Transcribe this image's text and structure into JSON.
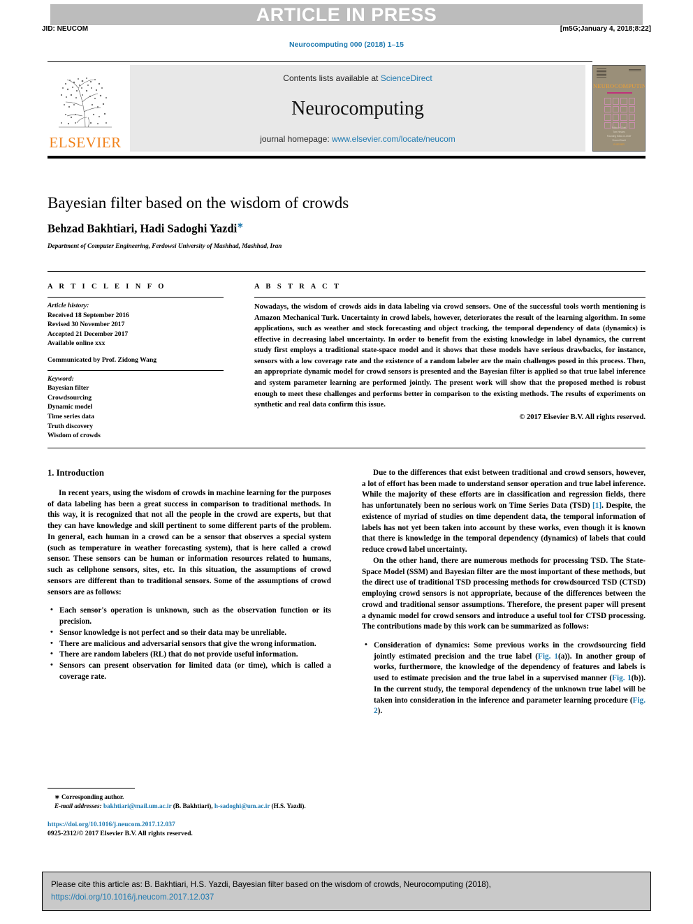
{
  "banner": {
    "press_label": "ARTICLE IN PRESS",
    "jid": "JID: NEUCOM",
    "build_stamp": "[m5G;January 4, 2018;8:22]",
    "journal_ref": "Neurocomputing 000 (2018) 1–15"
  },
  "masthead": {
    "contents_prefix": "Contents lists available at ",
    "sciencedirect": "ScienceDirect",
    "journal_name": "Neurocomputing",
    "homepage_prefix": "journal homepage: ",
    "homepage_url": "www.elsevier.com/locate/neucom",
    "publisher": "ELSEVIER",
    "cover_title": "NEUROCOMPUTING",
    "cover_sub": "AN INTERNATIONAL JOURNAL",
    "cover_line1": "Editor-in-Chief",
    "cover_line2": "Tom Heskes",
    "cover_line3": "Founding Editor-in-Chief",
    "cover_line4": "Vincent David",
    "cover_line5": "ELSEVIER"
  },
  "article": {
    "title": "Bayesian filter based on the wisdom of crowds",
    "authors": "Behzad Bakhtiari, Hadi Sadoghi Yazdi",
    "corresponding_marker": "∗",
    "affiliation": "Department of Computer Engineering, Ferdowsi University of Mashhad, Mashhad, Iran"
  },
  "info": {
    "heading": "A R T I C L E   I N F O",
    "history_label": "Article history:",
    "received": "Received 18 September 2016",
    "revised": "Revised 30 November 2017",
    "accepted": "Accepted 21 December 2017",
    "available": "Available online xxx",
    "communicated": "Communicated by Prof. Zidong Wang",
    "keyword_label": "Keyword:",
    "keywords": [
      "Bayesian filter",
      "Crowdsourcing",
      "Dynamic model",
      "Time series data",
      "Truth discovery",
      "Wisdom of crowds"
    ]
  },
  "abstract": {
    "heading": "A B S T R A C T",
    "text": "Nowadays, the wisdom of crowds aids in data labeling via crowd sensors. One of the successful tools worth mentioning is Amazon Mechanical Turk. Uncertainty in crowd labels, however, deteriorates the result of the learning algorithm. In some applications, such as weather and stock forecasting and object tracking, the temporal dependency of data (dynamics) is effective in decreasing label uncertainty. In order to benefit from the existing knowledge in label dynamics, the current study first employs a traditional state-space model and it shows that these models have serious drawbacks, for instance, sensors with a low coverage rate and the existence of a random labeler are the main challenges posed in this process. Then, an appropriate dynamic model for crowd sensors is presented and the Bayesian filter is applied so that true label inference and system parameter learning are performed jointly. The present work will show that the proposed method is robust enough to meet these challenges and performs better in comparison to the existing methods. The results of experiments on synthetic and real data confirm this issue.",
    "copyright": "© 2017 Elsevier B.V. All rights reserved."
  },
  "intro": {
    "heading": "1. Introduction",
    "para1": "In recent years, using the wisdom of crowds in machine learning for the purposes of data labeling has been a great success in comparison to traditional methods. In this way, it is recognized that not all the people in the crowd are experts, but that they can have knowledge and skill pertinent to some different parts of the problem. In general, each human in a crowd can be a sensor that observes a special system (such as temperature in weather forecasting system), that is here called a crowd sensor. These sensors can be human or information resources related to humans, such as cellphone sensors, sites, etc. In this situation, the assumptions of crowd sensors are different than to traditional sensors. Some of the assumptions of crowd sensors are as follows:",
    "bullets": [
      "Each sensor's operation is unknown, such as the observation function or its precision.",
      "Sensor knowledge is not perfect and so their data may be unreliable.",
      "There are malicious and adversarial sensors that give the wrong information.",
      "There are random labelers (RL) that do not provide useful information.",
      "Sensors can present observation for limited data (or time), which is called a coverage rate."
    ]
  },
  "right_col": {
    "para1": "Due to the differences that exist between traditional and crowd sensors, however, a lot of effort has been made to understand sensor operation and true label inference. While the majority of these efforts are in classification and regression fields, there has unfortunately been no serious work on Time Series Data (TSD)",
    "ref1": "[1]",
    "para1_cont": ". Despite, the existence of myriad of studies on time dependent data, the temporal information of labels has not yet been taken into account by these works, even though it is known that there is knowledge in the temporal dependency (dynamics) of labels that could reduce crowd label uncertainty.",
    "para2": "On the other hand, there are numerous methods for processing TSD. The State-Space Model (SSM) and Bayesian filter are the most important of these methods, but the direct use of traditional TSD processing methods for crowdsourced TSD (CTSD) employing crowd sensors is not appropriate, because of the differences between the crowd and traditional sensor assumptions. Therefore, the present paper will present a dynamic model for crowd sensors and introduce a useful tool for CTSD processing. The contributions made by this work can be summarized as follows:",
    "bullet1_a": "Consideration of dynamics: Some previous works in the crowdsourcing field jointly estimated precision and the true label (",
    "bullet1_fig1a": "Fig. 1",
    "bullet1_b": "(a)). In another group of works, furthermore, the knowledge of the dependency of features and labels is used to estimate precision and the true label in a supervised manner (",
    "bullet1_fig1b": "Fig. 1",
    "bullet1_c": "(b)). In the current study, the temporal dependency of the unknown true label will be taken into consideration in the inference and parameter learning procedure (",
    "bullet1_fig2": "Fig. 2",
    "bullet1_d": ")."
  },
  "footnote": {
    "corresponding": "Corresponding author.",
    "email_label": "E-mail addresses:",
    "email1": "bakhtiari@mail.um.ac.ir",
    "email1_owner": "(B. Bakhtiari),",
    "email2": "h-sadoghi@um.ac.ir",
    "email2_owner": "(H.S. Yazdi).",
    "doi": "https://doi.org/10.1016/j.neucom.2017.12.037",
    "issn": "0925-2312/© 2017 Elsevier B.V. All rights reserved."
  },
  "cite_footer": {
    "text": "Please cite this article as: B. Bakhtiari, H.S. Yazdi, Bayesian filter based on the wisdom of crowds, Neurocomputing (2018),",
    "doi": "https://doi.org/10.1016/j.neucom.2017.12.037"
  },
  "colors": {
    "link": "#1f7ab0",
    "banner_bg": "#bcbcbc",
    "elsevier_orange": "#f08019",
    "cite_bg": "#c9c9c9"
  }
}
